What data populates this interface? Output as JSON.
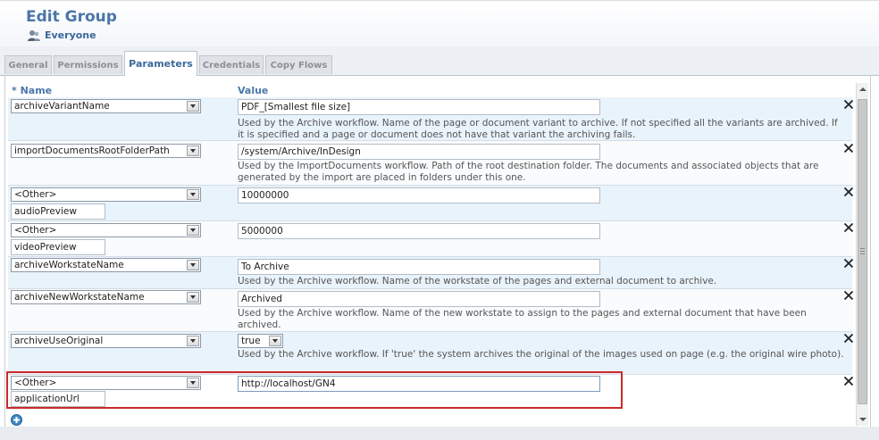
{
  "header": {
    "title": "Edit Group",
    "subtitle": "Everyone",
    "subtitle_icon": "user-icon"
  },
  "tabs": [
    {
      "label": "General",
      "active": false
    },
    {
      "label": "Permissions",
      "active": false
    },
    {
      "label": "Parameters",
      "active": true
    },
    {
      "label": "Credentials",
      "active": false
    },
    {
      "label": "Copy Flows",
      "active": false
    }
  ],
  "grid": {
    "columns": {
      "name": "* Name",
      "value": "Value"
    },
    "rows": [
      {
        "name_select": "archiveVariantName",
        "value": "PDF_[Smallest file size]",
        "description": "Used by the Archive workflow. Name of the page or document variant to archive. If not specified all the variants are archived. If it is specified and a page or document does not have that variant the archiving fails."
      },
      {
        "name_select": "importDocumentsRootFolderPath",
        "value": "/system/Archive/InDesign",
        "description": "Used by the ImportDocuments workflow. Path of the root destination folder. The documents and associated objects that are generated by the import are placed in folders under this one."
      },
      {
        "name_select": "<Other>",
        "custom_name": "audioPreview",
        "value": "10000000"
      },
      {
        "name_select": "<Other>",
        "custom_name": "videoPreview",
        "value": "5000000"
      },
      {
        "name_select": "archiveWorkstateName",
        "value": "To Archive",
        "description": "Used by the Archive workflow. Name of the workstate of the pages and external document to archive."
      },
      {
        "name_select": "archiveNewWorkstateName",
        "value": "Archived",
        "description": "Used by the Archive workflow. Name of the new workstate to assign to the pages and external document that have been archived."
      },
      {
        "name_select": "archiveUseOriginal",
        "value": "true",
        "description": "Used by the Archive workflow. If 'true' the system archives the original of the images used on page (e.g. the original wire photo)."
      },
      {
        "name_select": "<Other>",
        "custom_name": "applicationUrl",
        "value": "http://localhost/GN4",
        "highlighted": true
      }
    ],
    "remove_icon": "close-icon",
    "add_icon": "add-circle-icon"
  },
  "colors": {
    "accent": "#4a76a8",
    "row_tint": "#e9f3fb",
    "highlight": "#cc2929"
  }
}
